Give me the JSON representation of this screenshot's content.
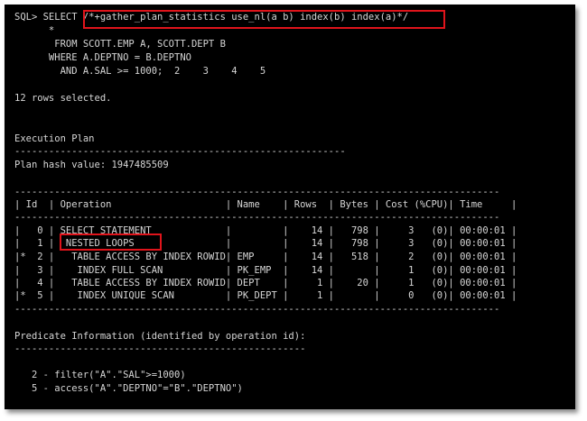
{
  "terminal": {
    "lines": [
      "SQL> SELECT /*+gather_plan_statistics use_nl(a b) index(b) index(a)*/",
      "      *",
      "       FROM SCOTT.EMP A, SCOTT.DEPT B",
      "      WHERE A.DEPTNO = B.DEPTNO",
      "        AND A.SAL >= 1000;  2    3    4    5",
      "",
      "12 rows selected.",
      "",
      "",
      "Execution Plan",
      "----------------------------------------------------------",
      "Plan hash value: 1947485509",
      "",
      "-------------------------------------------------------------------------------------",
      "| Id  | Operation                    | Name    | Rows  | Bytes | Cost (%CPU)| Time     |",
      "-------------------------------------------------------------------------------------",
      "|   0 | SELECT STATEMENT             |         |    14 |   798 |     3   (0)| 00:00:01 |",
      "|   1 |  NESTED LOOPS                |         |    14 |   798 |     3   (0)| 00:00:01 |",
      "|*  2 |   TABLE ACCESS BY INDEX ROWID| EMP     |    14 |   518 |     2   (0)| 00:00:01 |",
      "|   3 |    INDEX FULL SCAN           | PK_EMP  |    14 |       |     1   (0)| 00:00:01 |",
      "|   4 |   TABLE ACCESS BY INDEX ROWID| DEPT    |     1 |    20 |     1   (0)| 00:00:01 |",
      "|*  5 |    INDEX UNIQUE SCAN         | PK_DEPT |     1 |       |     0   (0)| 00:00:01 |",
      "-------------------------------------------------------------------------------------",
      "",
      "Predicate Information (identified by operation id):",
      "---------------------------------------------------",
      "",
      "   2 - filter(\"A\".\"SAL\">=1000)",
      "   5 - access(\"A\".\"DEPTNO\"=\"B\".\"DEPTNO\")"
    ]
  },
  "highlight_color": "#e0141b"
}
